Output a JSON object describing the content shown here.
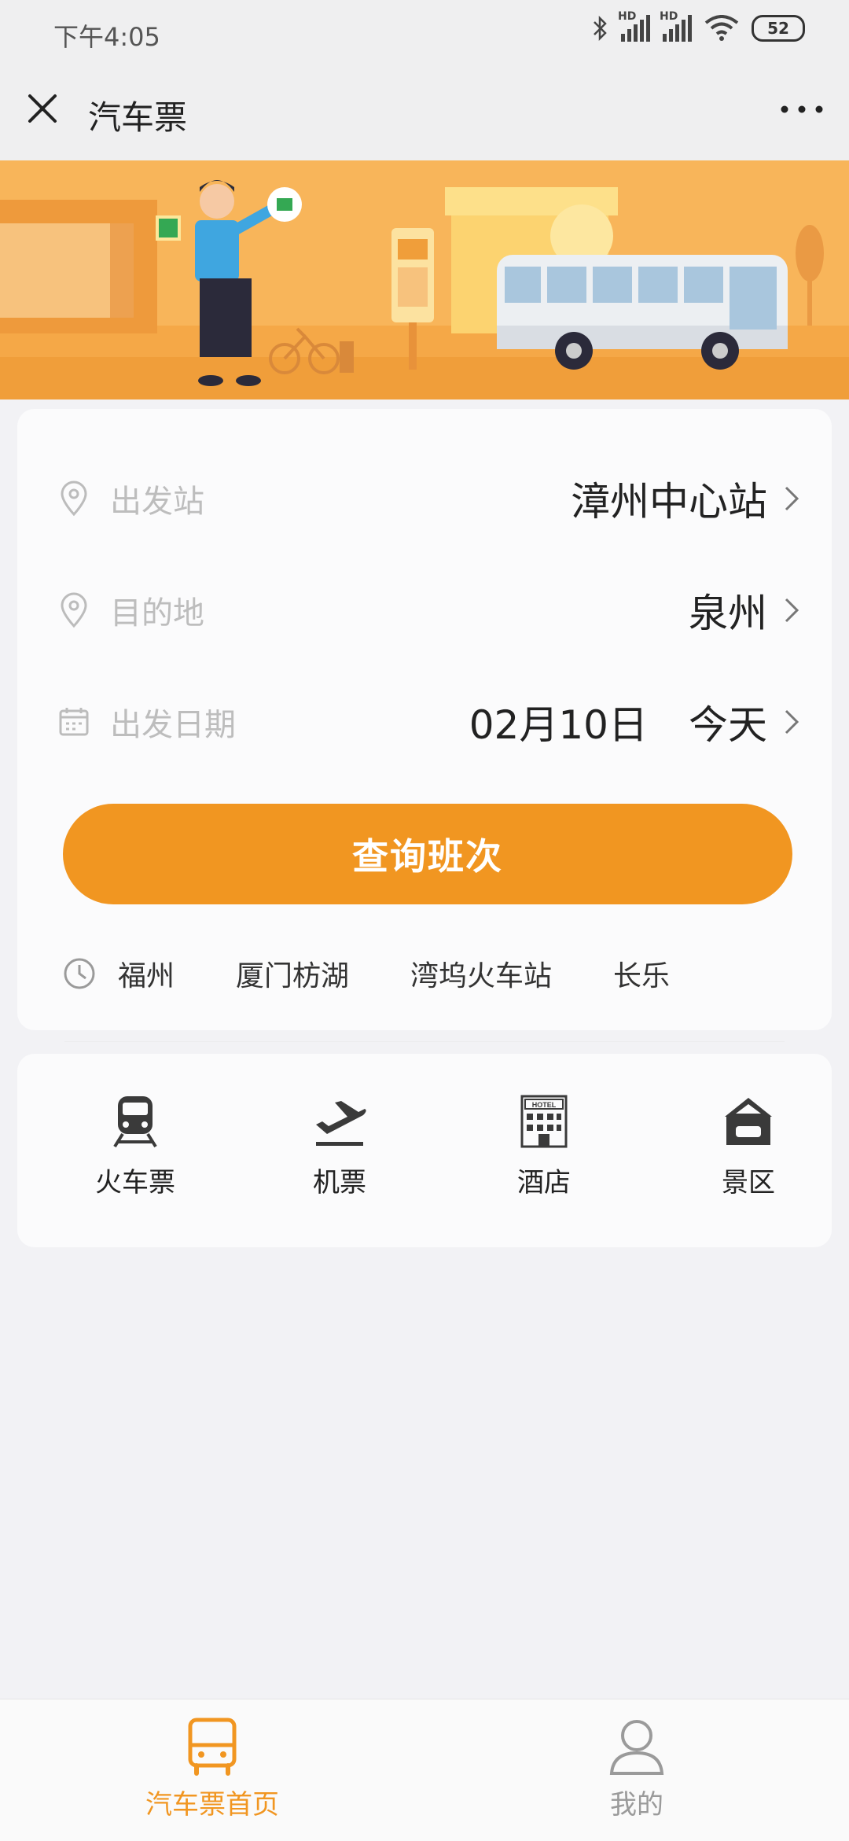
{
  "status_bar": {
    "time": "下午4:05",
    "battery": "52",
    "hd_label": "HD"
  },
  "header": {
    "title": "汽车票"
  },
  "form": {
    "departure_label": "出发站",
    "departure_value": "漳州中心站",
    "destination_label": "目的地",
    "destination_value": "泉州",
    "date_label": "出发日期",
    "date_value": "02月10日",
    "date_relative": "今天",
    "search_label": "查询班次"
  },
  "history": [
    "福州",
    "厦门枋湖",
    "湾坞火车站",
    "长乐"
  ],
  "services": [
    {
      "label": "火车票",
      "icon": "train-icon"
    },
    {
      "label": "机票",
      "icon": "plane-icon"
    },
    {
      "label": "酒店",
      "icon": "hotel-icon"
    },
    {
      "label": "景区",
      "icon": "scenic-icon"
    }
  ],
  "hotel_sign": "HOTEL",
  "tabbar": {
    "home_label": "汽车票首页",
    "mine_label": "我的",
    "active": "home"
  },
  "colors": {
    "accent": "#f19621",
    "banner": "#f7b455",
    "background": "#f2f2f5"
  }
}
